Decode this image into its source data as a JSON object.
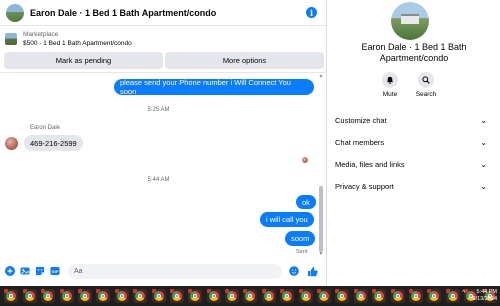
{
  "chat_header": {
    "title": "Earon Dale · 1 Bed 1 Bath Apartment/condo",
    "info_icon": "info-icon"
  },
  "marketplace": {
    "label": "Marketplace",
    "listing": "$500 · 1 Bed 1 Bath Apartment/condo"
  },
  "actions": {
    "pending_label": "Mark as pending",
    "more_label": "More options"
  },
  "messages": {
    "out_1": "please send your Phone number i Will Connect You soon",
    "time_1": "5:25 AM",
    "sender": "Earon Dale",
    "in_1": "469-216-2599",
    "time_2": "5:44 AM",
    "out_2": "ok",
    "out_3": "i will call you",
    "out_4": "soom",
    "sent_status": "Sent"
  },
  "composer": {
    "placeholder": "Aa",
    "icons": [
      "plus-circle-icon",
      "photo-icon",
      "sticker-icon",
      "gif-icon",
      "emoji-icon",
      "thumbs-up-icon"
    ],
    "accent": "#0a7cff"
  },
  "info_panel": {
    "name": "Earon Dale · 1 Bed 1 Bath Apartment/condo",
    "mute_label": "Mute",
    "search_label": "Search",
    "sections": [
      "Customize chat",
      "Chat members",
      "Media, files and links",
      "Privacy & support"
    ]
  },
  "taskbar": {
    "app_icon": "chrome-icon",
    "app_count": 27,
    "time": "5:44 PM",
    "date": "9/13/2024"
  },
  "colors": {
    "accent": "#0a7cff",
    "bubble_in": "#e4e6eb",
    "taskbar": "#1f1f1f"
  }
}
